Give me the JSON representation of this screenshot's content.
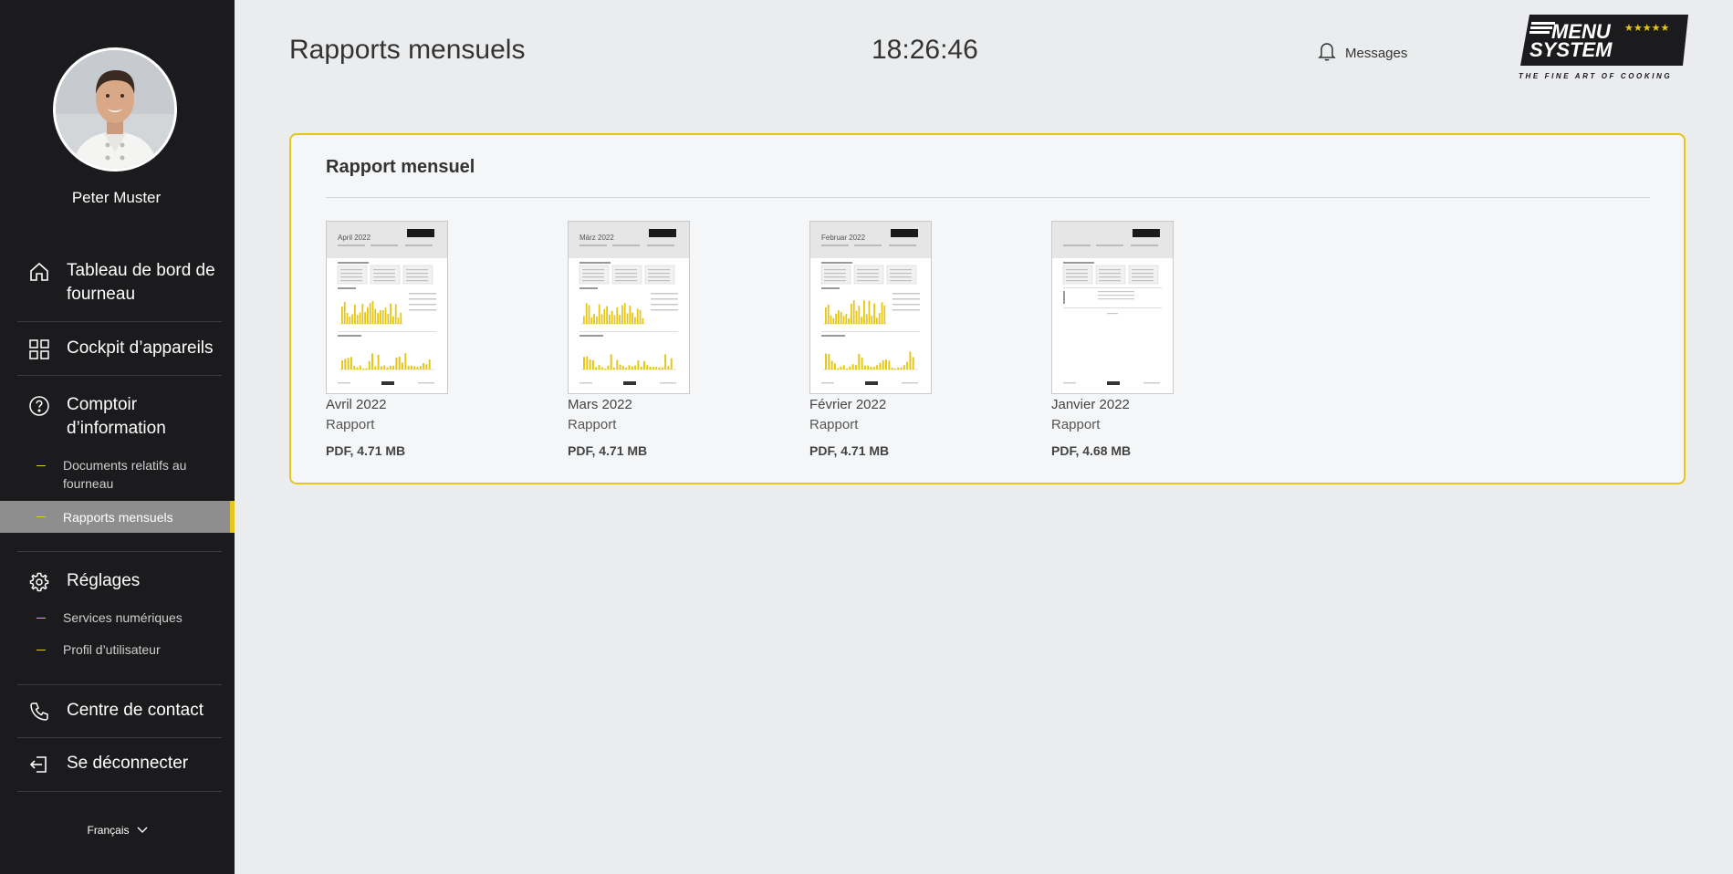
{
  "sidebar": {
    "user_name": "Peter Muster",
    "nav": {
      "dashboard": "Tableau de bord de fourneau",
      "cockpit": "Cockpit d’appareils",
      "info": "Comptoir d’information",
      "settings": "Réglages",
      "contact": "Centre de contact",
      "logout": "Se déconnecter"
    },
    "sub": {
      "documents": "Documents relatifs au fourneau",
      "monthly_reports": "Rapports mensuels",
      "digital_services": "Services numériques",
      "user_profile": "Profil d’utilisateur"
    },
    "language": "Français"
  },
  "header": {
    "title": "Rapports mensuels",
    "clock": "18:26:46",
    "messages_label": "Messages"
  },
  "logo": {
    "line1": "MENU",
    "line2": "SYSTEM",
    "stars": "★★★★★",
    "tagline": "THE FINE ART OF COOKING"
  },
  "card": {
    "title": "Rapport mensuel",
    "reports": [
      {
        "thumb_title": "April 2022",
        "name": "Avril 2022",
        "type": "Rapport",
        "size": "PDF, 4.71 MB"
      },
      {
        "thumb_title": "März 2022",
        "name": "Mars 2022",
        "type": "Rapport",
        "size": "PDF, 4.71 MB"
      },
      {
        "thumb_title": "Februar 2022",
        "name": "Février 2022",
        "type": "Rapport",
        "size": "PDF, 4.71 MB"
      },
      {
        "thumb_title": "",
        "name": "Janvier 2022",
        "type": "Rapport",
        "size": "PDF, 4.68 MB"
      }
    ]
  },
  "colors": {
    "accent": "#e6c619",
    "sidebar_bg": "#1b1a1c",
    "page_bg": "#ebeced"
  }
}
